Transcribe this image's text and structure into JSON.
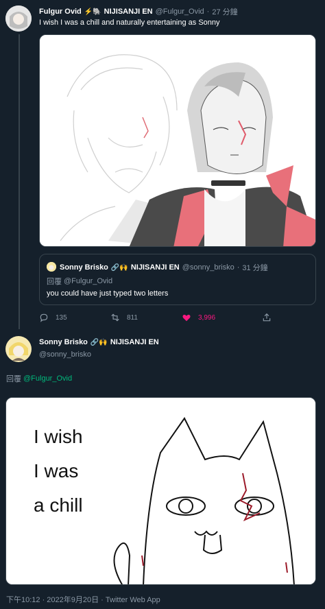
{
  "tweet1": {
    "display_name": "Fulgur Ovid",
    "name_emoji": "⚡🐘",
    "org": "NIJISANJI EN",
    "handle": "@Fulgur_Ovid",
    "separator": "·",
    "time": "27 分鐘",
    "text": "I wish I was a chill and naturally entertaining as Sonny"
  },
  "quote": {
    "display_name": "Sonny Brisko",
    "name_emoji": "🔗🙌",
    "org": "NIJISANJI EN",
    "handle": "@sonny_brisko",
    "separator": "·",
    "time": "31 分鐘",
    "reply_prefix": "回覆",
    "reply_to": "@Fulgur_Ovid",
    "text": "you could have just typed two letters"
  },
  "actions": {
    "replies": "135",
    "retweets": "811",
    "likes": "3,996"
  },
  "tweet2": {
    "display_name": "Sonny Brisko",
    "name_emoji": "🔗🙌",
    "org": "NIJISANJI EN",
    "handle": "@sonny_brisko",
    "reply_prefix": "回覆",
    "reply_to": "@Fulgur_Ovid",
    "drawing_text": [
      "I wish",
      "I was",
      "a chill"
    ]
  },
  "footer": {
    "timestamp": "下午10:12 · 2022年9月20日 · Twitter Web App"
  },
  "colors": {
    "background": "#15202b",
    "muted": "#8b98a5",
    "like": "#f91880",
    "mention": "#00ba7c"
  }
}
